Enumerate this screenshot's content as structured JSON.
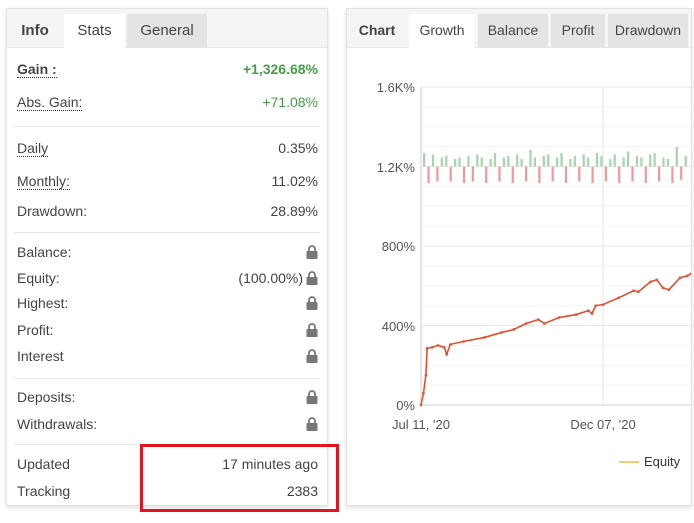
{
  "left": {
    "tabs": [
      {
        "label": "Info"
      },
      {
        "label": "Stats"
      },
      {
        "label": "General"
      }
    ],
    "active_tab": "Stats",
    "gain": {
      "label": "Gain :",
      "value": "+1,326.68%"
    },
    "abs_gain": {
      "label": "Abs. Gain:",
      "value": "+71.08%"
    },
    "daily": {
      "label": "Daily",
      "value": "0.35%"
    },
    "monthly": {
      "label": "Monthly:",
      "value": "11.02%"
    },
    "drawdown": {
      "label": "Drawdown:",
      "value": "28.89%"
    },
    "balance": {
      "label": "Balance:"
    },
    "equity": {
      "label": "Equity:",
      "value": "(100.00%)"
    },
    "highest": {
      "label": "Highest:"
    },
    "profit": {
      "label": "Profit:"
    },
    "interest": {
      "label": "Interest"
    },
    "deposits": {
      "label": "Deposits:"
    },
    "withdrawals": {
      "label": "Withdrawals:"
    },
    "updated": {
      "label": "Updated",
      "value": "17 minutes ago"
    },
    "tracking": {
      "label": "Tracking",
      "value": "2383"
    },
    "lock_icon": "lock-icon",
    "highlight_color": "#e3141f"
  },
  "right": {
    "tabs": [
      {
        "label": "Chart"
      },
      {
        "label": "Growth"
      },
      {
        "label": "Balance"
      },
      {
        "label": "Profit"
      },
      {
        "label": "Drawdown"
      }
    ],
    "active_tab": "Growth"
  },
  "chart_data": {
    "type": "line",
    "yticks": [
      "0%",
      "400%",
      "800%",
      "1.2K%",
      "1.6K%"
    ],
    "ylim": [
      0,
      1600
    ],
    "xticks": [
      "Jul 11, '20",
      "Dec 07, '20"
    ],
    "grid": true,
    "legend": {
      "entries": [
        "Equity"
      ],
      "placement": "bottom"
    },
    "series": [
      {
        "name": "Equity",
        "color": "#e0502f",
        "points": [
          [
            "2020-07-11",
            0
          ],
          [
            "2020-07-13",
            60
          ],
          [
            "2020-07-15",
            150
          ],
          [
            "2020-07-16",
            285
          ],
          [
            "2020-07-20",
            290
          ],
          [
            "2020-07-25",
            300
          ],
          [
            "2020-07-30",
            290
          ],
          [
            "2020-08-01",
            255
          ],
          [
            "2020-08-04",
            305
          ],
          [
            "2020-08-15",
            320
          ],
          [
            "2020-09-01",
            340
          ],
          [
            "2020-09-15",
            365
          ],
          [
            "2020-09-25",
            380
          ],
          [
            "2020-10-05",
            410
          ],
          [
            "2020-10-15",
            430
          ],
          [
            "2020-10-20",
            410
          ],
          [
            "2020-11-01",
            440
          ],
          [
            "2020-11-15",
            455
          ],
          [
            "2020-11-25",
            475
          ],
          [
            "2020-11-28",
            460
          ],
          [
            "2020-12-01",
            500
          ],
          [
            "2020-12-07",
            505
          ],
          [
            "2020-12-20",
            540
          ],
          [
            "2021-01-01",
            575
          ],
          [
            "2021-01-05",
            570
          ],
          [
            "2021-01-15",
            620
          ],
          [
            "2021-01-20",
            630
          ],
          [
            "2021-01-25",
            590
          ],
          [
            "2021-01-30",
            580
          ],
          [
            "2021-02-08",
            640
          ],
          [
            "2021-02-14",
            650
          ],
          [
            "2021-02-17",
            660
          ]
        ]
      }
    ],
    "daily_bars": {
      "baseline": 1200,
      "positive_color": "#a5d6a7",
      "negative_color": "#ef9a9a",
      "values": [
        90,
        -110,
        80,
        -100,
        60,
        70,
        -100,
        50,
        60,
        -110,
        70,
        -100,
        80,
        60,
        -110,
        50,
        90,
        -100,
        60,
        70,
        -110,
        80,
        50,
        -100,
        110,
        60,
        -110,
        70,
        80,
        -100,
        60,
        90,
        -110,
        50,
        70,
        -100,
        80,
        60,
        -110,
        90,
        70,
        -100,
        50,
        80,
        -110,
        60,
        100,
        -100,
        70,
        60,
        -110,
        80,
        90,
        -100,
        60,
        50,
        -110,
        130,
        -90,
        70
      ]
    }
  }
}
